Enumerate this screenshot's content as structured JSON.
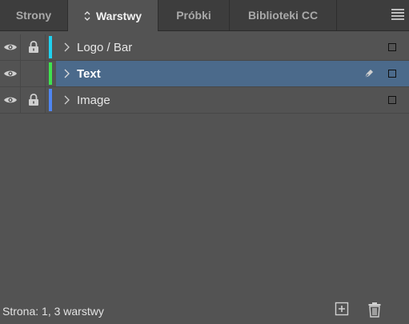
{
  "tabs": [
    {
      "label": "Strony",
      "active": false
    },
    {
      "label": "Warstwy",
      "active": true
    },
    {
      "label": "Próbki",
      "active": false
    },
    {
      "label": "Biblioteki CC",
      "active": false
    }
  ],
  "layers": [
    {
      "name": "Logo / Bar",
      "visible": true,
      "locked": true,
      "color": "#1fd2f0",
      "selected": false,
      "target_icon": "square-icon"
    },
    {
      "name": "Text",
      "visible": true,
      "locked": false,
      "color": "#3fe24f",
      "selected": true,
      "target_icon": "square-icon",
      "extra_icon": "pen-icon"
    },
    {
      "name": "Image",
      "visible": true,
      "locked": true,
      "color": "#4f86f2",
      "selected": false,
      "target_icon": "square-icon"
    }
  ],
  "footer": {
    "status": "Strona: 1, 3 warstwy",
    "new_icon": "new-layer-icon",
    "delete_icon": "trash-icon"
  },
  "colors": {
    "panel_bg": "#535353",
    "tabbar_bg": "#3d3d3d",
    "selected_row": "#4b6a8b"
  }
}
